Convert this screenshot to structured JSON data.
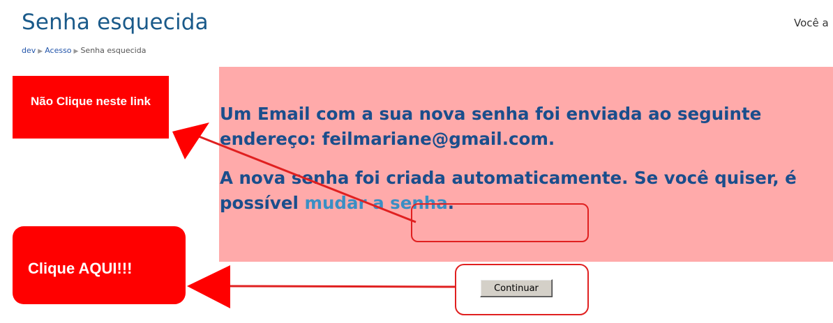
{
  "header": {
    "title": "Senha esquecida",
    "login_info": "Você a"
  },
  "breadcrumb": {
    "items": [
      "dev",
      "Acesso",
      "Senha esquecida"
    ],
    "separator": "▶"
  },
  "message": {
    "line1": "Um Email com a sua nova senha foi enviada ao seguinte endereço: feilmariane@gmail.com.",
    "line2_prefix": "A nova senha foi criada automaticamente. Se você quiser, é possível ",
    "link_text": "mudar a senha",
    "line2_suffix": "."
  },
  "continue_button": {
    "label": "Continuar"
  },
  "annotations": {
    "dont_click": "Não Clique neste link",
    "click_here": "Clique AQUI!!!",
    "color": "#ff0000"
  },
  "colors": {
    "title": "#1a5a8a",
    "message_bg": "#ffaaaa",
    "message_text": "#1a4e8c",
    "link": "#3a8fc4"
  }
}
